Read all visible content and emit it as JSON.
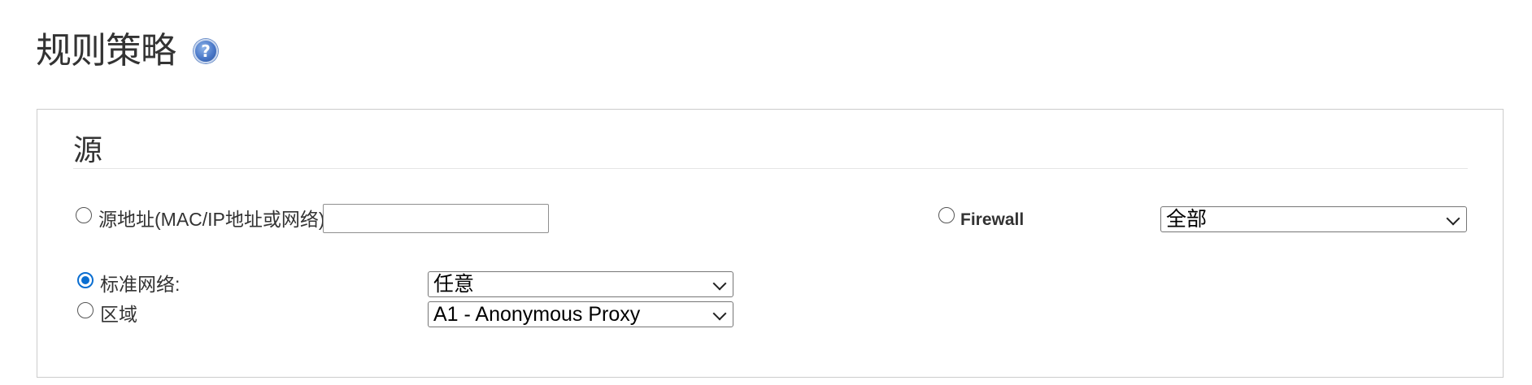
{
  "page": {
    "title": "规则策略",
    "help_icon": "question-mark-icon",
    "help_symbol": "?"
  },
  "source_panel": {
    "heading": "源",
    "source_address": {
      "label": "源地址(MAC/IP地址或网络)",
      "value": "",
      "checked": false
    },
    "firewall": {
      "label": "Firewall",
      "checked": false,
      "selected": "全部"
    },
    "standard_network": {
      "label": "标准网络:",
      "checked": true,
      "selected": "任意"
    },
    "region": {
      "label": "区域",
      "checked": false,
      "selected": "A1 - Anonymous Proxy"
    }
  },
  "colors": {
    "radio_checked": "#0a6ed1",
    "help_icon": "#4a78c8"
  }
}
